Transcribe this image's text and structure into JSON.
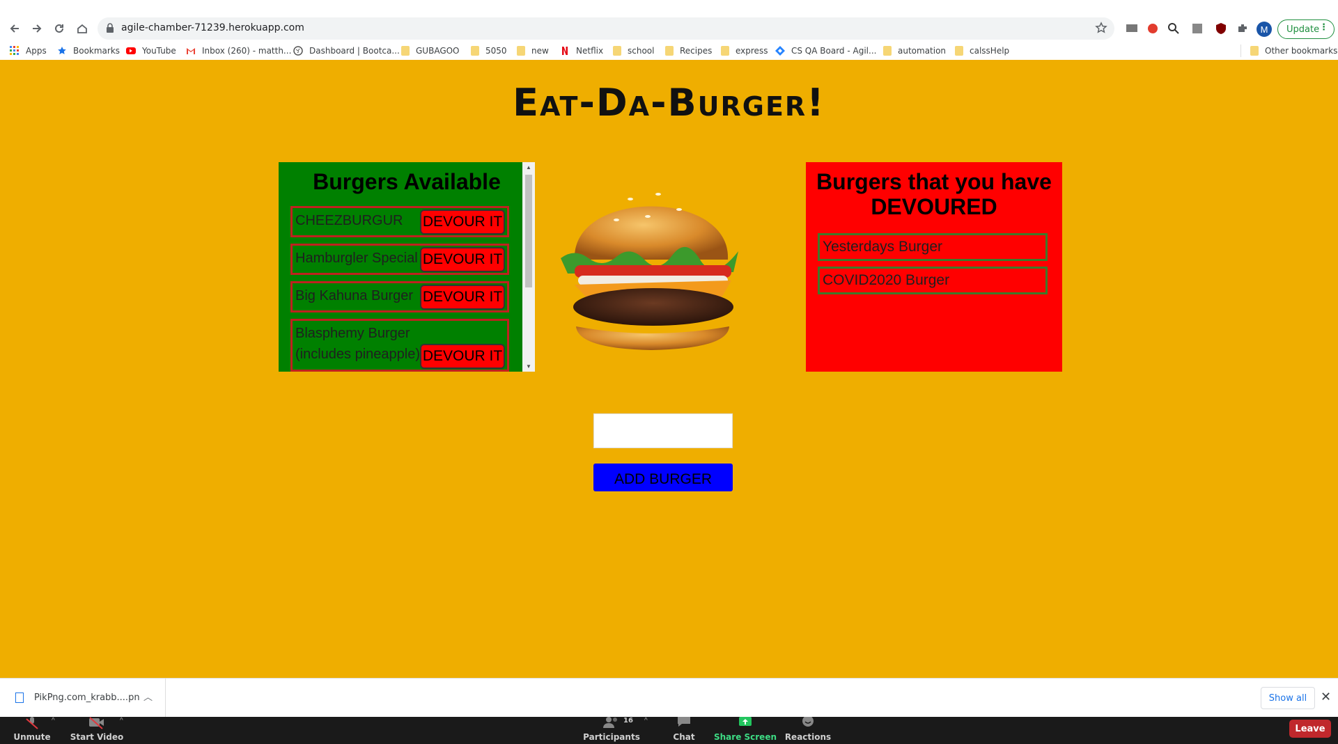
{
  "browser": {
    "url": "agile-chamber-71239.herokuapp.com",
    "profile_initial": "M",
    "update_label": "Update",
    "bookmarks": [
      "Apps",
      "Bookmarks",
      "YouTube",
      "Inbox (260) - matth...",
      "Dashboard | Bootca...",
      "GUBAGOO",
      "5050",
      "new",
      "Netflix",
      "school",
      "Recipes",
      "express",
      "CS QA Board - Agil...",
      "automation",
      "calssHelp"
    ],
    "other_bookmarks": "Other bookmarks"
  },
  "page": {
    "title": "Eat-Da-Burger!",
    "available_heading": "Burgers Available",
    "available": [
      {
        "name": "CHEEZBURGUR",
        "button": "DEVOUR IT"
      },
      {
        "name": "Hamburgler Special",
        "button": "DEVOUR IT"
      },
      {
        "name": "Big Kahuna Burger",
        "button": "DEVOUR IT"
      },
      {
        "name": "Blasphemy Burger (includes pineapple)",
        "button": "DEVOUR IT"
      }
    ],
    "devoured_heading": "Burgers that you have DEVOURED",
    "devoured": [
      "Yesterdays Burger",
      "COVID2020 Burger"
    ],
    "input_value": "",
    "add_button": "ADD BURGER"
  },
  "downloads": {
    "file_name": "PikPng.com_krabb....pn",
    "show_all": "Show all"
  },
  "zoom": {
    "unmute": "Unmute",
    "start_video": "Start Video",
    "participants": "Participants",
    "participants_count": "16",
    "chat": "Chat",
    "share_screen": "Share Screen",
    "reactions": "Reactions",
    "leave": "Leave"
  },
  "colors": {
    "page_bg": "#efae00",
    "available_bg": "#008000",
    "devoured_bg": "#ff0000",
    "devour_button": "#ff0000",
    "add_button": "#0000ff",
    "share_screen": "#22c55e"
  }
}
